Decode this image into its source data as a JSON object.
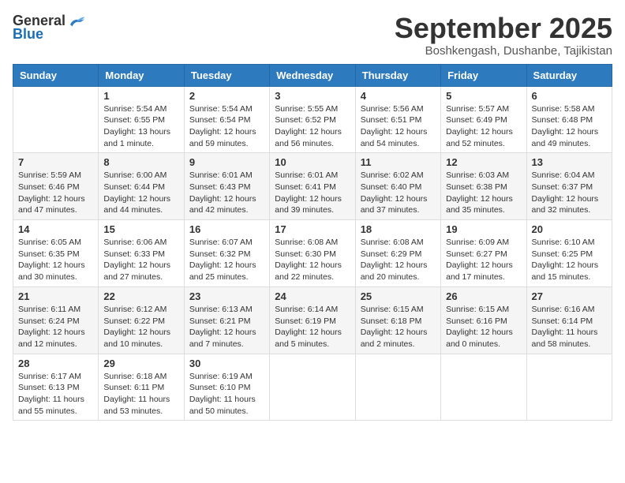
{
  "logo": {
    "text_general": "General",
    "text_blue": "Blue"
  },
  "title": "September 2025",
  "location": "Boshkengash, Dushanbe, Tajikistan",
  "weekdays": [
    "Sunday",
    "Monday",
    "Tuesday",
    "Wednesday",
    "Thursday",
    "Friday",
    "Saturday"
  ],
  "weeks": [
    [
      {
        "day": "",
        "sunrise": "",
        "sunset": "",
        "daylight": ""
      },
      {
        "day": "1",
        "sunrise": "Sunrise: 5:54 AM",
        "sunset": "Sunset: 6:55 PM",
        "daylight": "Daylight: 13 hours and 1 minute."
      },
      {
        "day": "2",
        "sunrise": "Sunrise: 5:54 AM",
        "sunset": "Sunset: 6:54 PM",
        "daylight": "Daylight: 12 hours and 59 minutes."
      },
      {
        "day": "3",
        "sunrise": "Sunrise: 5:55 AM",
        "sunset": "Sunset: 6:52 PM",
        "daylight": "Daylight: 12 hours and 56 minutes."
      },
      {
        "day": "4",
        "sunrise": "Sunrise: 5:56 AM",
        "sunset": "Sunset: 6:51 PM",
        "daylight": "Daylight: 12 hours and 54 minutes."
      },
      {
        "day": "5",
        "sunrise": "Sunrise: 5:57 AM",
        "sunset": "Sunset: 6:49 PM",
        "daylight": "Daylight: 12 hours and 52 minutes."
      },
      {
        "day": "6",
        "sunrise": "Sunrise: 5:58 AM",
        "sunset": "Sunset: 6:48 PM",
        "daylight": "Daylight: 12 hours and 49 minutes."
      }
    ],
    [
      {
        "day": "7",
        "sunrise": "Sunrise: 5:59 AM",
        "sunset": "Sunset: 6:46 PM",
        "daylight": "Daylight: 12 hours and 47 minutes."
      },
      {
        "day": "8",
        "sunrise": "Sunrise: 6:00 AM",
        "sunset": "Sunset: 6:44 PM",
        "daylight": "Daylight: 12 hours and 44 minutes."
      },
      {
        "day": "9",
        "sunrise": "Sunrise: 6:01 AM",
        "sunset": "Sunset: 6:43 PM",
        "daylight": "Daylight: 12 hours and 42 minutes."
      },
      {
        "day": "10",
        "sunrise": "Sunrise: 6:01 AM",
        "sunset": "Sunset: 6:41 PM",
        "daylight": "Daylight: 12 hours and 39 minutes."
      },
      {
        "day": "11",
        "sunrise": "Sunrise: 6:02 AM",
        "sunset": "Sunset: 6:40 PM",
        "daylight": "Daylight: 12 hours and 37 minutes."
      },
      {
        "day": "12",
        "sunrise": "Sunrise: 6:03 AM",
        "sunset": "Sunset: 6:38 PM",
        "daylight": "Daylight: 12 hours and 35 minutes."
      },
      {
        "day": "13",
        "sunrise": "Sunrise: 6:04 AM",
        "sunset": "Sunset: 6:37 PM",
        "daylight": "Daylight: 12 hours and 32 minutes."
      }
    ],
    [
      {
        "day": "14",
        "sunrise": "Sunrise: 6:05 AM",
        "sunset": "Sunset: 6:35 PM",
        "daylight": "Daylight: 12 hours and 30 minutes."
      },
      {
        "day": "15",
        "sunrise": "Sunrise: 6:06 AM",
        "sunset": "Sunset: 6:33 PM",
        "daylight": "Daylight: 12 hours and 27 minutes."
      },
      {
        "day": "16",
        "sunrise": "Sunrise: 6:07 AM",
        "sunset": "Sunset: 6:32 PM",
        "daylight": "Daylight: 12 hours and 25 minutes."
      },
      {
        "day": "17",
        "sunrise": "Sunrise: 6:08 AM",
        "sunset": "Sunset: 6:30 PM",
        "daylight": "Daylight: 12 hours and 22 minutes."
      },
      {
        "day": "18",
        "sunrise": "Sunrise: 6:08 AM",
        "sunset": "Sunset: 6:29 PM",
        "daylight": "Daylight: 12 hours and 20 minutes."
      },
      {
        "day": "19",
        "sunrise": "Sunrise: 6:09 AM",
        "sunset": "Sunset: 6:27 PM",
        "daylight": "Daylight: 12 hours and 17 minutes."
      },
      {
        "day": "20",
        "sunrise": "Sunrise: 6:10 AM",
        "sunset": "Sunset: 6:25 PM",
        "daylight": "Daylight: 12 hours and 15 minutes."
      }
    ],
    [
      {
        "day": "21",
        "sunrise": "Sunrise: 6:11 AM",
        "sunset": "Sunset: 6:24 PM",
        "daylight": "Daylight: 12 hours and 12 minutes."
      },
      {
        "day": "22",
        "sunrise": "Sunrise: 6:12 AM",
        "sunset": "Sunset: 6:22 PM",
        "daylight": "Daylight: 12 hours and 10 minutes."
      },
      {
        "day": "23",
        "sunrise": "Sunrise: 6:13 AM",
        "sunset": "Sunset: 6:21 PM",
        "daylight": "Daylight: 12 hours and 7 minutes."
      },
      {
        "day": "24",
        "sunrise": "Sunrise: 6:14 AM",
        "sunset": "Sunset: 6:19 PM",
        "daylight": "Daylight: 12 hours and 5 minutes."
      },
      {
        "day": "25",
        "sunrise": "Sunrise: 6:15 AM",
        "sunset": "Sunset: 6:18 PM",
        "daylight": "Daylight: 12 hours and 2 minutes."
      },
      {
        "day": "26",
        "sunrise": "Sunrise: 6:15 AM",
        "sunset": "Sunset: 6:16 PM",
        "daylight": "Daylight: 12 hours and 0 minutes."
      },
      {
        "day": "27",
        "sunrise": "Sunrise: 6:16 AM",
        "sunset": "Sunset: 6:14 PM",
        "daylight": "Daylight: 11 hours and 58 minutes."
      }
    ],
    [
      {
        "day": "28",
        "sunrise": "Sunrise: 6:17 AM",
        "sunset": "Sunset: 6:13 PM",
        "daylight": "Daylight: 11 hours and 55 minutes."
      },
      {
        "day": "29",
        "sunrise": "Sunrise: 6:18 AM",
        "sunset": "Sunset: 6:11 PM",
        "daylight": "Daylight: 11 hours and 53 minutes."
      },
      {
        "day": "30",
        "sunrise": "Sunrise: 6:19 AM",
        "sunset": "Sunset: 6:10 PM",
        "daylight": "Daylight: 11 hours and 50 minutes."
      },
      {
        "day": "",
        "sunrise": "",
        "sunset": "",
        "daylight": ""
      },
      {
        "day": "",
        "sunrise": "",
        "sunset": "",
        "daylight": ""
      },
      {
        "day": "",
        "sunrise": "",
        "sunset": "",
        "daylight": ""
      },
      {
        "day": "",
        "sunrise": "",
        "sunset": "",
        "daylight": ""
      }
    ]
  ]
}
